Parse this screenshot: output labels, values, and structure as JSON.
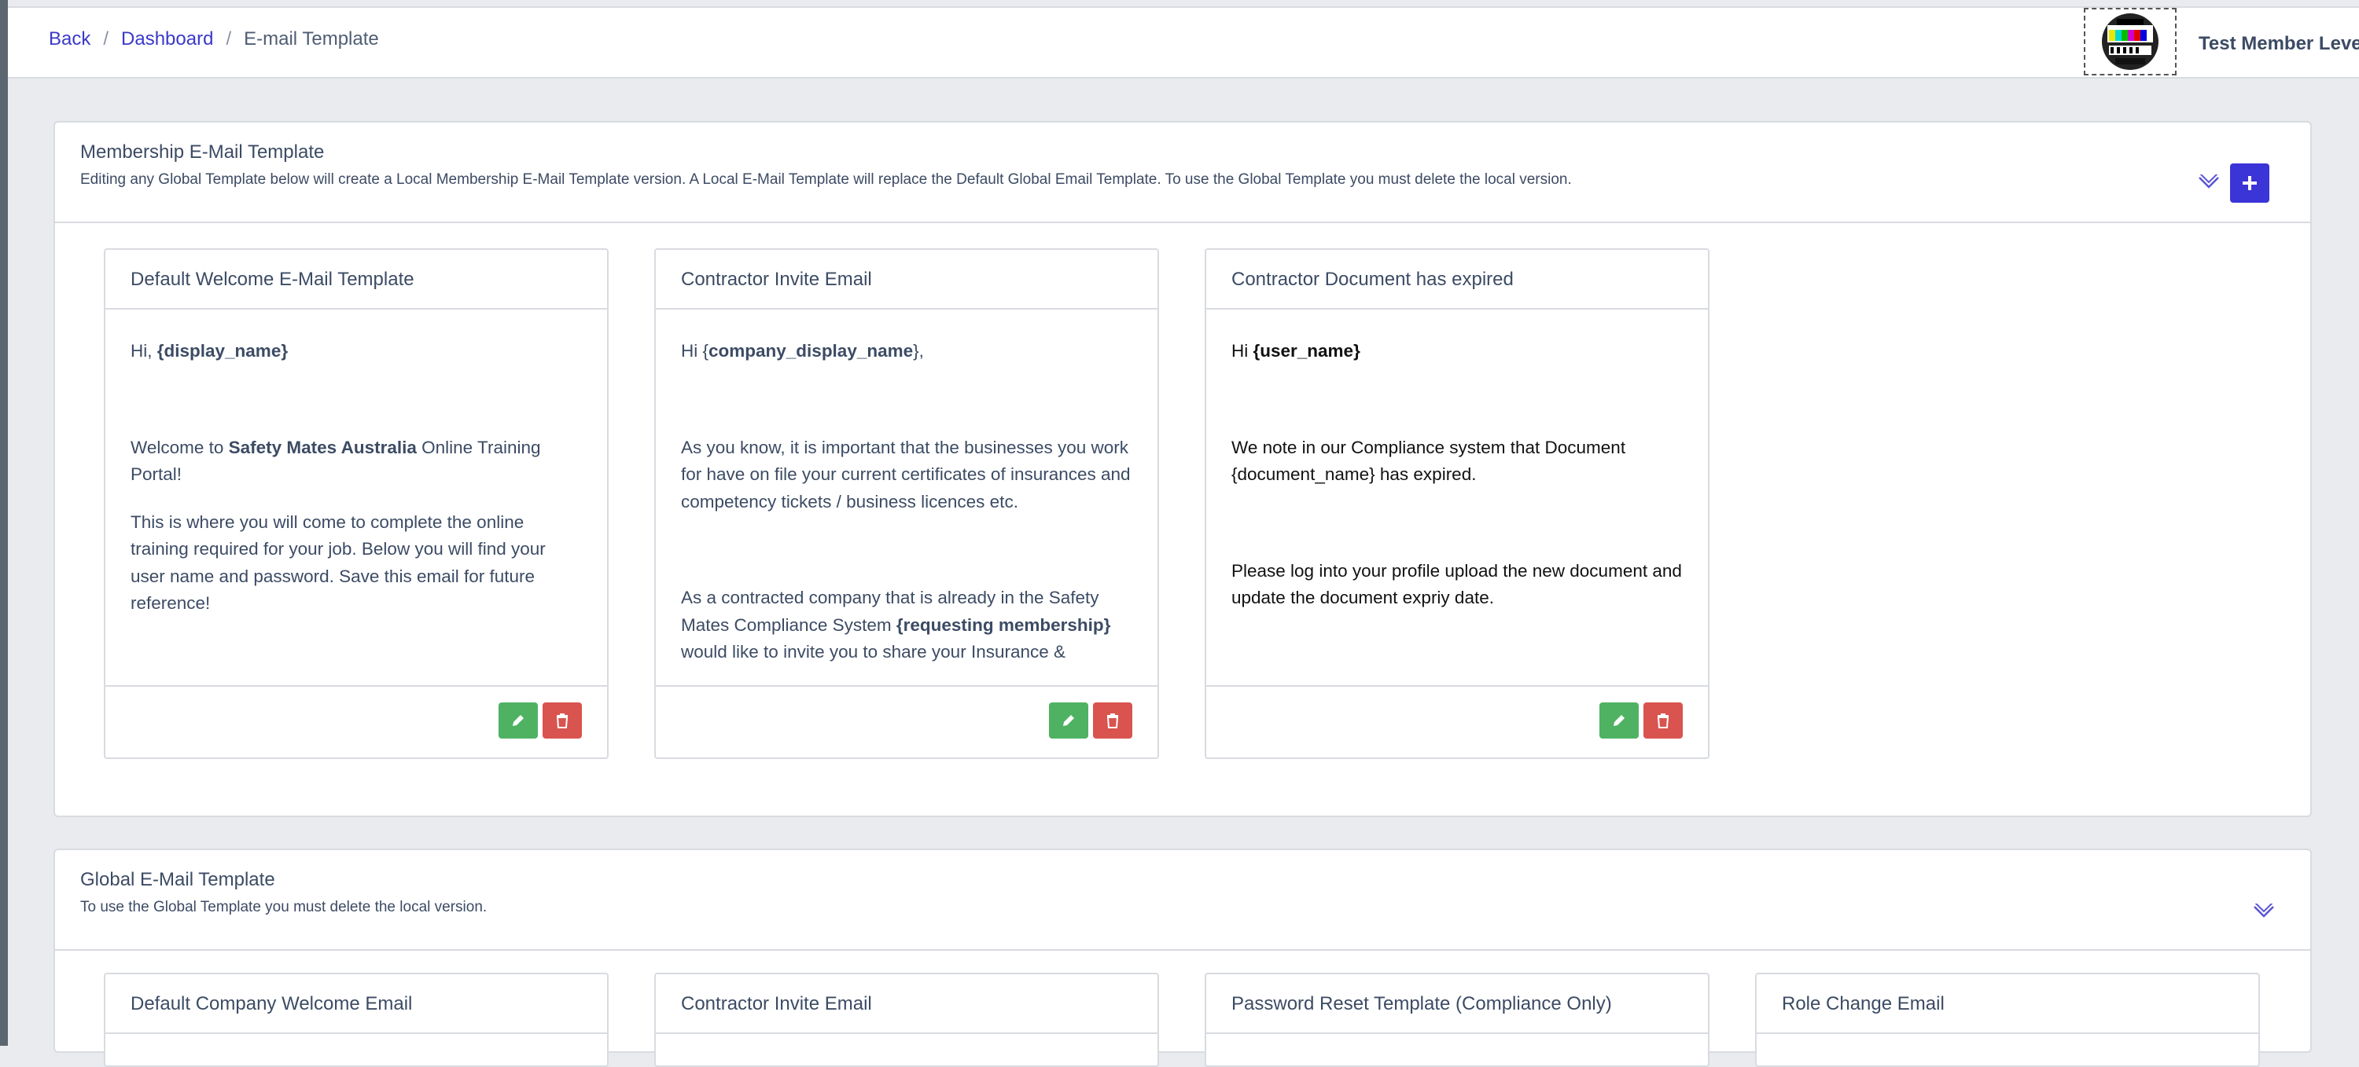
{
  "breadcrumb": {
    "back": "Back",
    "dashboard": "Dashboard",
    "current": "E-mail Template"
  },
  "user": {
    "name": "Test Member Level"
  },
  "membership_section": {
    "title": "Membership E-Mail Template",
    "subtitle": "Editing any Global Template below will create a Local Membership E-Mail Template version. A Local E-Mail Template will replace the Default Global Email Template. To use the Global Template you must delete the local version.",
    "add_icon": "plus-icon",
    "cards": [
      {
        "title": "Default Welcome E-Mail Template",
        "greeting": {
          "pre": "Hi, ",
          "var": "{display_name}"
        },
        "p1": {
          "pre": "Welcome to ",
          "bold": "Safety Mates Australia",
          "post": " Online Training Portal!"
        },
        "p2": "This is where you will come to complete the online training required for your job. Below you will find your user name and password. Save this email for future reference!"
      },
      {
        "title": "Contractor Invite Email",
        "greeting": {
          "pre": "Hi {",
          "var": "company_display_name",
          "post": "},"
        },
        "p1": "As you know, it is important that the businesses you work for have on file your current certificates of insurances and competency tickets / business licences etc.",
        "p2": {
          "pre": "As a contracted company that is already in the Safety Mates Compliance System ",
          "bold": "{requesting  membership}",
          "post": " would like to invite you to share your Insurance &"
        }
      },
      {
        "title": "Contractor Document has expired",
        "greeting": {
          "pre": "Hi ",
          "var": "{user_name}"
        },
        "p1": "We note in our Compliance system that Document {document_name} has expired.",
        "p2": "Please log into your profile upload the new document and update the document expriy date."
      }
    ]
  },
  "global_section": {
    "title": "Global E-Mail Template",
    "subtitle": "To use the Global Template you must delete the local version.",
    "cards": [
      {
        "title": "Default Company Welcome Email"
      },
      {
        "title": "Contractor Invite Email"
      },
      {
        "title": "Password Reset Template (Compliance Only)"
      },
      {
        "title": "Role Change Email"
      }
    ]
  },
  "icons": {
    "edit": "pencil-icon",
    "delete": "trash-icon",
    "collapse": "chevron-down-icon"
  },
  "colors": {
    "primary": "#3b34d6",
    "success": "#4fb263",
    "danger": "#d9534f",
    "link": "#3b39c9"
  }
}
